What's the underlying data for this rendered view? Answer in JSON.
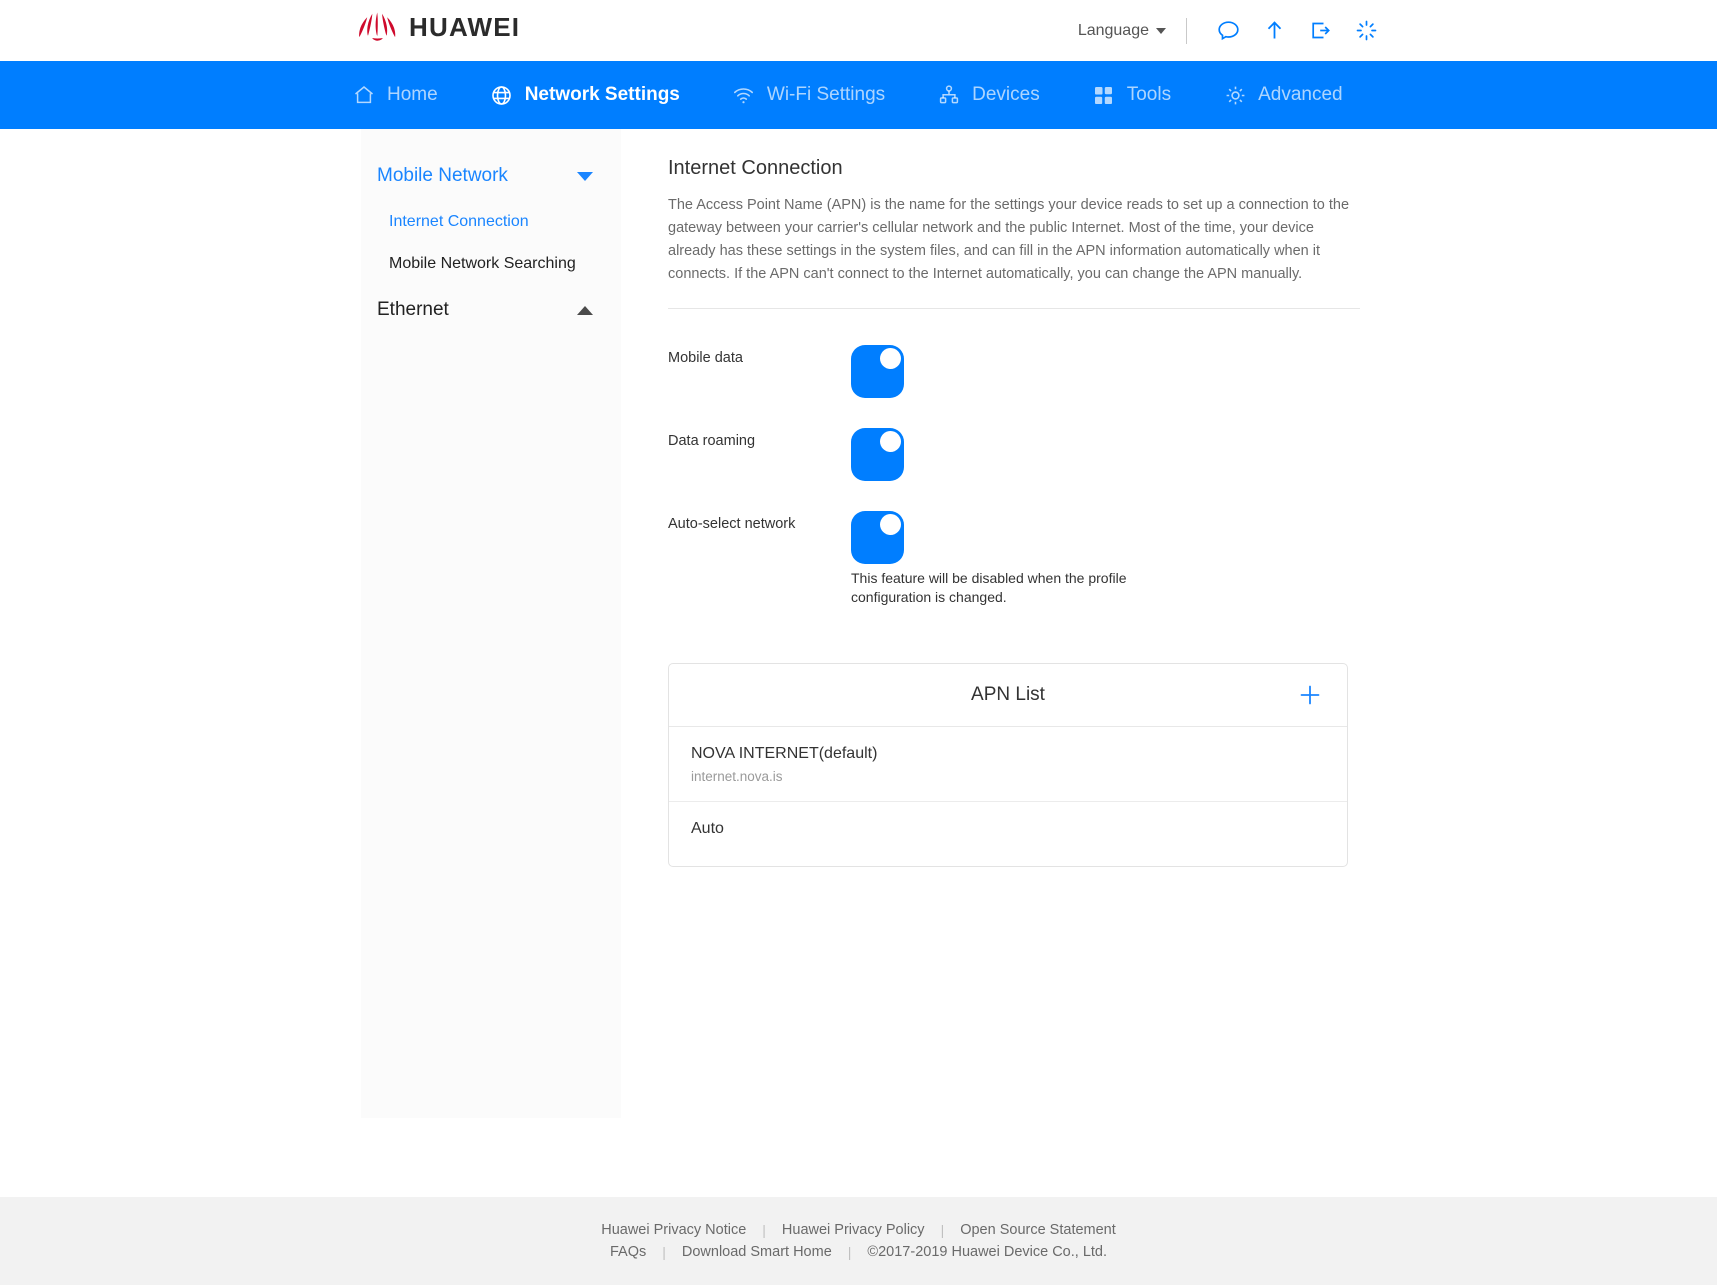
{
  "brand": {
    "name": "HUAWEI",
    "logo_color": "#CF0A2C"
  },
  "topbar": {
    "language_label": "Language",
    "icons": [
      {
        "name": "chat-bubble-icon"
      },
      {
        "name": "upload-arrow-icon"
      },
      {
        "name": "logout-icon"
      },
      {
        "name": "refresh-spinner-icon"
      }
    ]
  },
  "nav": {
    "accent_color": "#007EFF",
    "items": [
      {
        "label": "Home",
        "icon": "home-icon",
        "active": false
      },
      {
        "label": "Network Settings",
        "icon": "globe-icon",
        "active": true
      },
      {
        "label": "Wi-Fi Settings",
        "icon": "wifi-icon",
        "active": false
      },
      {
        "label": "Devices",
        "icon": "sitemap-icon",
        "active": false
      },
      {
        "label": "Tools",
        "icon": "grid-icon",
        "active": false
      },
      {
        "label": "Advanced",
        "icon": "gear-icon",
        "active": false
      }
    ]
  },
  "sidebar": {
    "groups": [
      {
        "label": "Mobile Network",
        "expanded": true,
        "items": [
          {
            "label": "Internet Connection",
            "active": true
          },
          {
            "label": "Mobile Network Searching",
            "active": false
          }
        ]
      },
      {
        "label": "Ethernet",
        "expanded": false,
        "items": []
      }
    ]
  },
  "main": {
    "title": "Internet Connection",
    "description": "The Access Point Name (APN) is the name for the settings your device reads to set up a connection to the gateway between your carrier's cellular network and the public Internet. Most of the time, your device already has these settings in the system files, and can fill in the APN information automatically when it connects. If the APN can't connect to the Internet automatically, you can change the APN manually.",
    "toggles": [
      {
        "label": "Mobile data",
        "value": "on",
        "hint": ""
      },
      {
        "label": "Data roaming",
        "value": "on",
        "hint": ""
      },
      {
        "label": "Auto-select network",
        "value": "on",
        "hint": "This feature will be disabled when the profile configuration is changed."
      }
    ],
    "apn_list": {
      "title": "APN List",
      "add_icon": "plus-icon",
      "rows": [
        {
          "name": "NOVA INTERNET(default)",
          "sub": "internet.nova.is"
        },
        {
          "name": "Auto",
          "sub": ""
        }
      ]
    }
  },
  "footer": {
    "row1": [
      "Huawei Privacy Notice",
      "Huawei Privacy Policy",
      "Open Source Statement"
    ],
    "row2": [
      "FAQs",
      "Download Smart Home"
    ],
    "copyright": "©2017-2019 Huawei Device Co., Ltd.",
    "separator": "|"
  }
}
